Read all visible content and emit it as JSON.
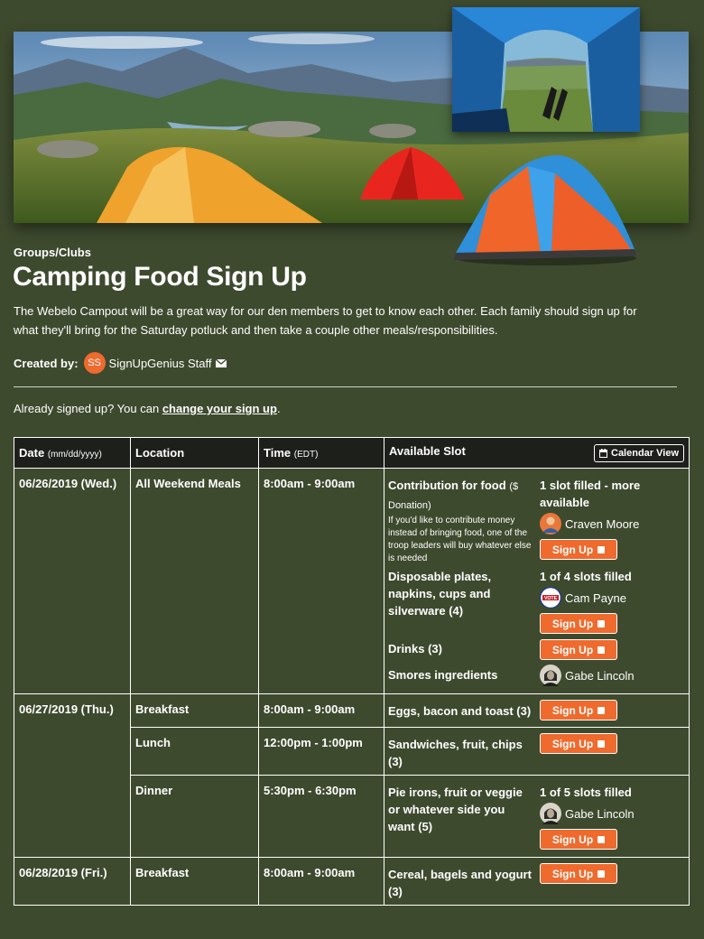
{
  "header": {
    "category": "Groups/Clubs",
    "title": "Camping Food Sign Up",
    "description": "The Webelo Campout will be a great way for our den members to get to know each other. Each family should sign up for what they'll bring for the Saturday potluck and then take a couple other meals/responsibilities.",
    "created_by_label": "Created by:",
    "creator_initials": "SS",
    "creator_name": "SignUpGenius Staff",
    "already_prefix": "Already signed up? You can ",
    "change_link": "change your sign up",
    "already_suffix": "."
  },
  "table": {
    "headers": {
      "date": "Date",
      "date_hint": "(mm/dd/yyyy)",
      "location": "Location",
      "time": "Time",
      "time_hint": "(EDT)",
      "slot": "Available Slot",
      "calendar_view": "Calendar View"
    },
    "signup_label": "Sign Up",
    "rows": [
      {
        "date": "06/26/2019 (Wed.)",
        "location": "All Weekend Meals",
        "time": "8:00am - 9:00am",
        "slots": [
          {
            "item": "Contribution for food",
            "item_sub": "($ Donation)",
            "note": "If you'd like to contribute money instead of bringing food, one of the troop leaders will buy whatever else is needed",
            "status": "1 slot filled - more available",
            "person": "Craven Moore"
          },
          {
            "item": "Disposable plates, napkins, cups and silverware (4)",
            "status": "1 of 4 slots filled",
            "person": "Cam Payne"
          },
          {
            "item": "Drinks (3)"
          },
          {
            "item": "Smores ingredients",
            "person": "Gabe Lincoln"
          }
        ]
      },
      {
        "date": "06/27/2019 (Thu.)",
        "subrows": [
          {
            "location": "Breakfast",
            "time": "8:00am - 9:00am",
            "item": "Eggs, bacon and toast (3)"
          },
          {
            "location": "Lunch",
            "time": "12:00pm - 1:00pm",
            "item": "Sandwiches, fruit, chips (3)"
          },
          {
            "location": "Dinner",
            "time": "5:30pm - 6:30pm",
            "item": "Pie irons, fruit or veggie or whatever side you want (5)",
            "status": "1 of 5 slots filled",
            "person": "Gabe Lincoln"
          }
        ]
      },
      {
        "date": "06/28/2019 (Fri.)",
        "location": "Breakfast",
        "time": "8:00am - 9:00am",
        "item": "Cereal, bagels and yogurt (3)"
      }
    ]
  },
  "icons": {
    "calendar": "calendar-icon",
    "mail": "mail-icon",
    "checkbox": "checkbox-icon",
    "vote_badge": "VOTE"
  },
  "colors": {
    "background": "#3e4a2e",
    "accent": "#ef6a2d",
    "header_row": "#1d1f1b"
  }
}
